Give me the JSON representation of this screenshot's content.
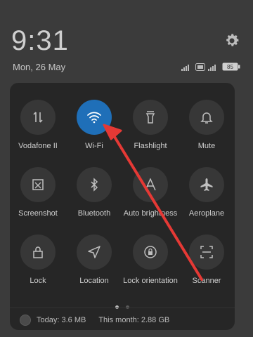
{
  "clock": "9:31",
  "date": "Mon, 26 May",
  "status": {
    "battery_label": "85"
  },
  "tiles": [
    {
      "label": "Vodafone II",
      "icon": "mobile-data-icon"
    },
    {
      "label": "Wi-Fi",
      "icon": "wifi-icon",
      "active": true
    },
    {
      "label": "Flashlight",
      "icon": "flashlight-icon"
    },
    {
      "label": "Mute",
      "icon": "bell-icon"
    },
    {
      "label": "Screenshot",
      "icon": "screenshot-icon"
    },
    {
      "label": "Bluetooth",
      "icon": "bluetooth-icon"
    },
    {
      "label": "Auto brightness",
      "icon": "auto-brightness-icon"
    },
    {
      "label": "Aeroplane",
      "icon": "airplane-icon"
    },
    {
      "label": "Lock",
      "icon": "lock-icon"
    },
    {
      "label": "Location",
      "icon": "location-icon"
    },
    {
      "label": "Lock orientation",
      "icon": "rotation-lock-icon"
    },
    {
      "label": "Scanner",
      "icon": "scanner-icon"
    }
  ],
  "data_usage": {
    "today": "Today: 3.6 MB",
    "month": "This month: 2.88 GB"
  },
  "colors": {
    "accent": "#1f6fb8",
    "annotation_arrow": "#e53935"
  }
}
